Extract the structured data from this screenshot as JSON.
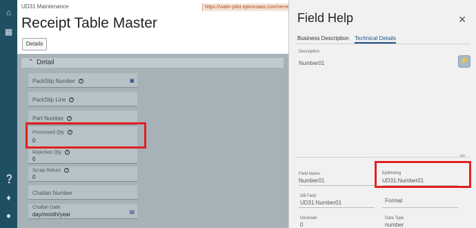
{
  "rail": {
    "icons": [
      "home-icon",
      "apps-grid-icon",
      "help-icon",
      "notifications-icon",
      "user-icon"
    ]
  },
  "app": {
    "crumb": "UD31 Maintenance",
    "url": "https://viatin-pilot.epicorsaas.com/server",
    "title": "Receipt Table Master",
    "details_button": "Details",
    "section_label": "Detail",
    "fields": [
      {
        "label": "PackSlip Number",
        "value": ""
      },
      {
        "label": "PackSlip Line",
        "value": ""
      },
      {
        "label": "Part Number",
        "value": ""
      },
      {
        "label": "Processed Qty",
        "value": "0"
      },
      {
        "label": "Rejection Qty",
        "value": "0"
      },
      {
        "label": "Scrap Return",
        "value": "0"
      },
      {
        "label": "Challan Number",
        "value": ""
      },
      {
        "label": "Challan Date",
        "value": "day/month/year"
      }
    ]
  },
  "help": {
    "title": "Field Help",
    "tabs": [
      "Business Description",
      "Technical Details"
    ],
    "active_tab": "Technical Details",
    "description_label": "Description",
    "description_value": "Number01",
    "field_name_label": "Field Name",
    "field_name_value": "Number01",
    "epbinding_label": "EpBinding",
    "epbinding_value": "UD31.Number01",
    "db_field_label": "DB Field",
    "db_field_value": "UD31.Number01",
    "format_label": "Format",
    "decimals_label": "Decimals",
    "decimals_value": "0",
    "data_type_label": "Data Type",
    "data_type_value": "number"
  },
  "colors": {
    "rail": "#1f4f63",
    "highlight": "#e02020",
    "active_tab": "#1d4f8a"
  }
}
